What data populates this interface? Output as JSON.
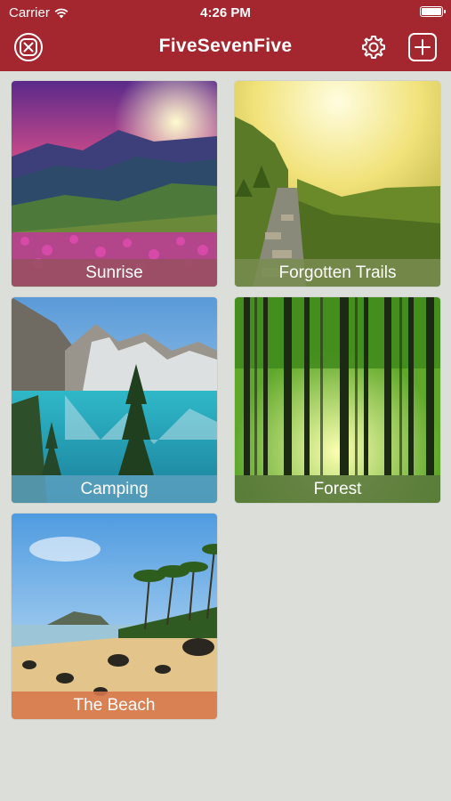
{
  "status": {
    "carrier": "Carrier",
    "time": "4:26 PM"
  },
  "nav": {
    "title": "FiveSevenFive",
    "close_icon": "close-icon",
    "settings_icon": "gear-icon",
    "add_icon": "plus-icon"
  },
  "colors": {
    "nav_bar": "#a4262f",
    "background": "#dcdfd9"
  },
  "grid": {
    "items": [
      {
        "label": "Sunrise"
      },
      {
        "label": "Forgotten Trails"
      },
      {
        "label": "Camping"
      },
      {
        "label": "Forest"
      },
      {
        "label": "The Beach"
      }
    ]
  }
}
